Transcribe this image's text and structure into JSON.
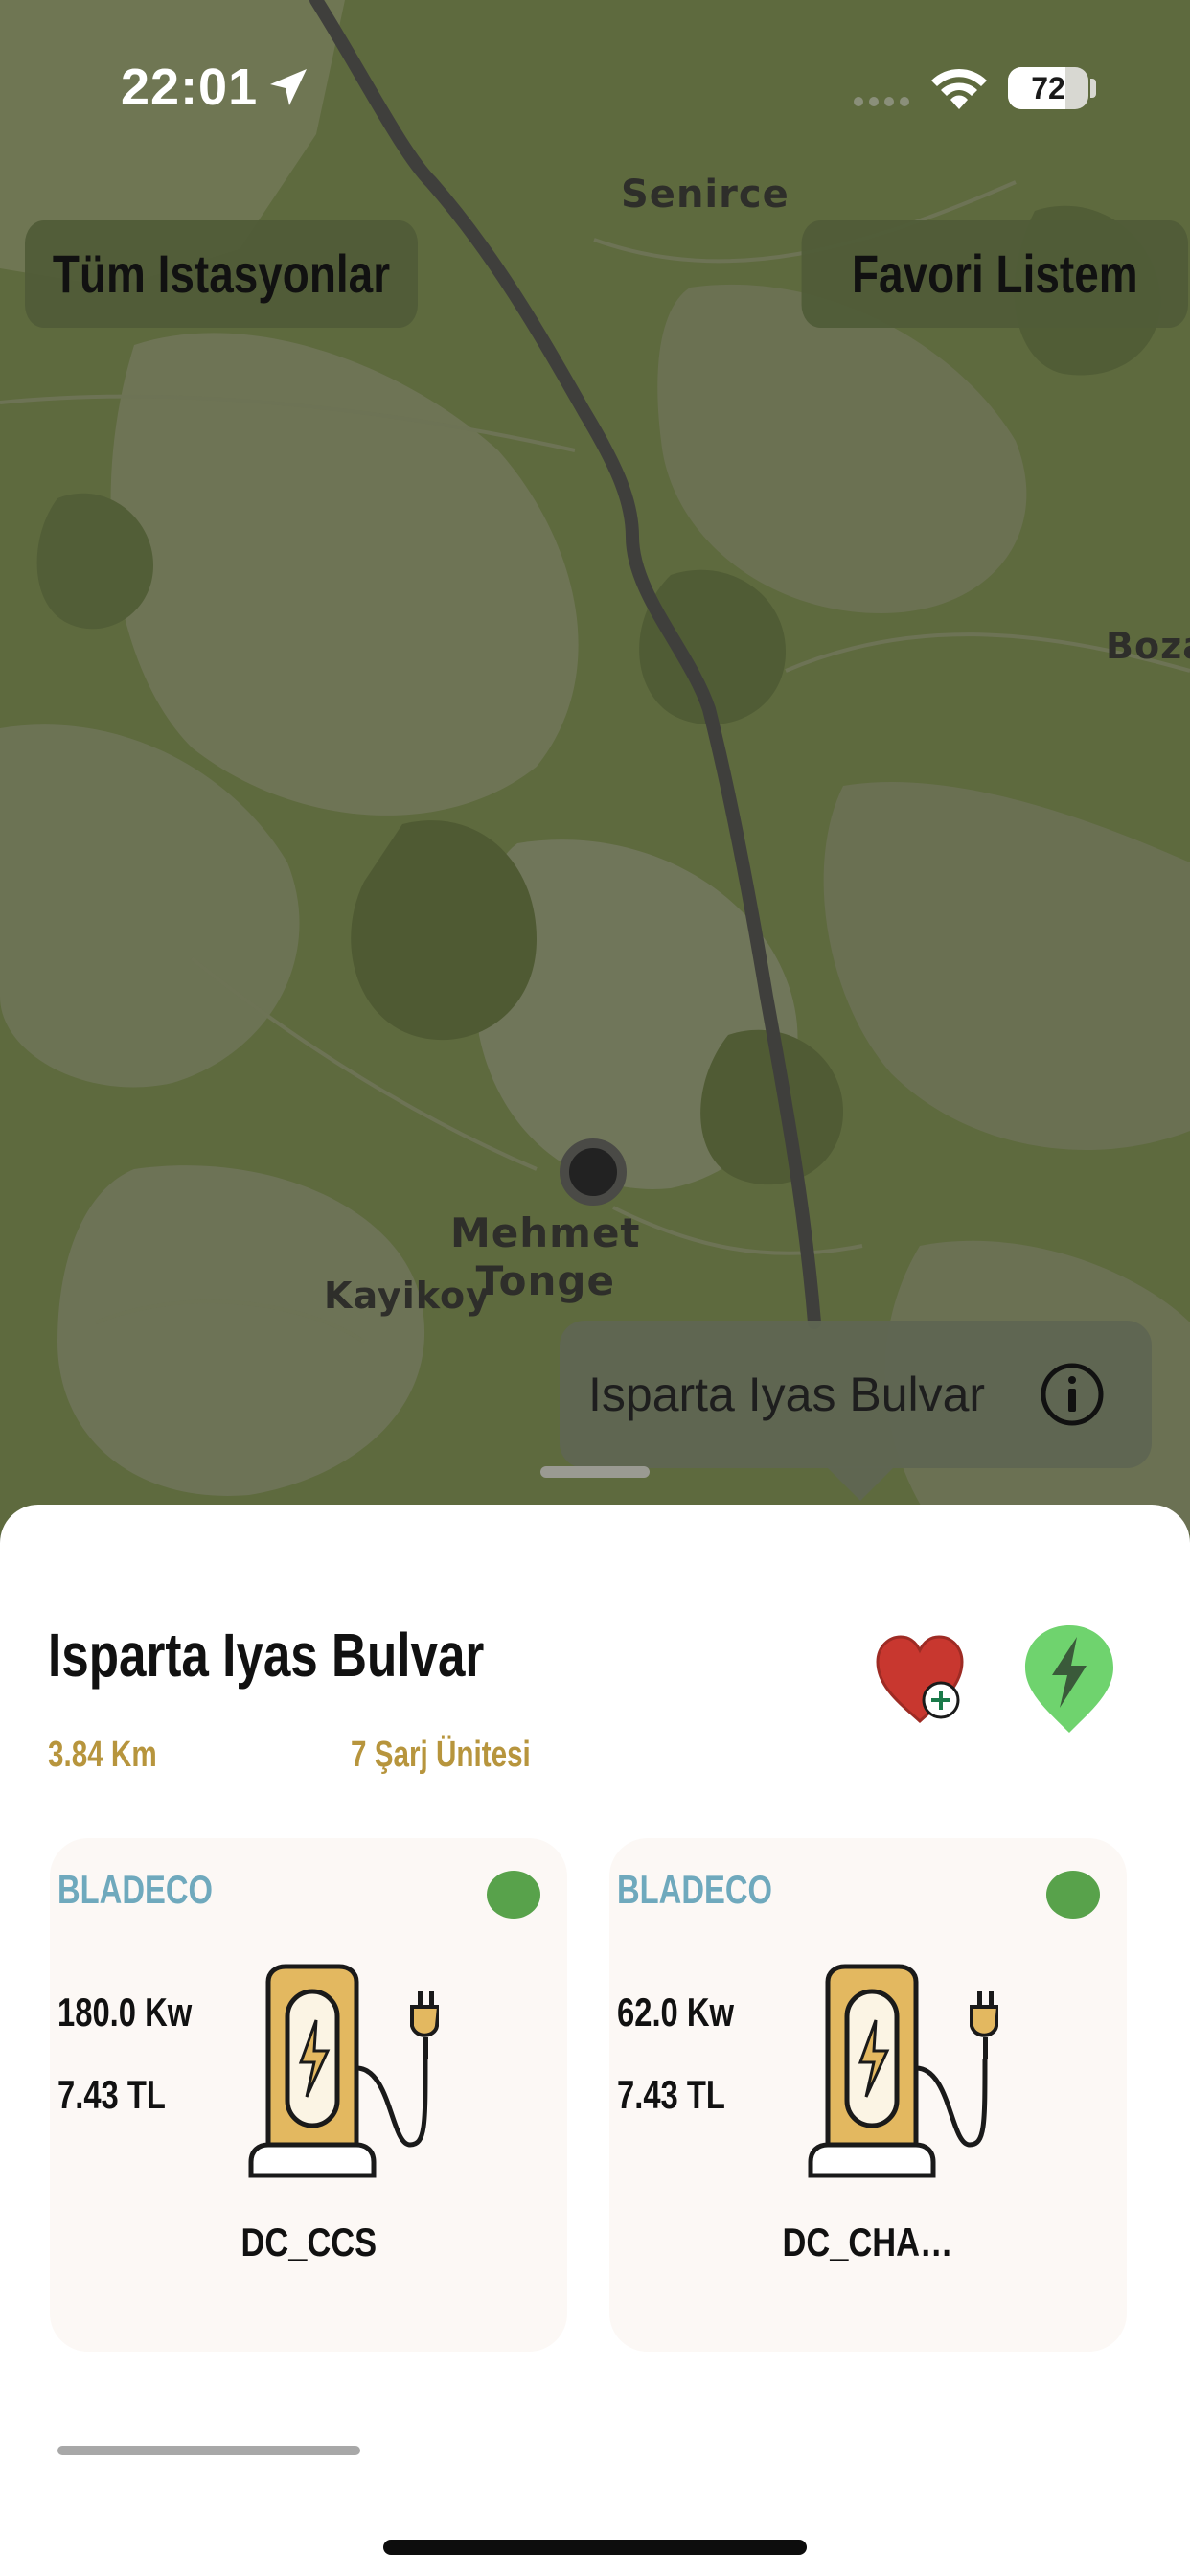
{
  "status_bar": {
    "time": "22:01",
    "battery": "72",
    "battery_level": 0.72,
    "location_icon": "location-arrow-icon",
    "wifi_icon": "wifi-icon"
  },
  "map": {
    "labels": {
      "senirce": "Senirce",
      "boza": "Boza",
      "mehmet": "Mehmet",
      "tonge": "Tonge",
      "kayikoy": "Kayikoy"
    },
    "buttons": {
      "all_stations": "Tüm Istasyonlar",
      "favorites": "Favori Listem"
    },
    "callout": {
      "title": "Isparta Iyas Bulvar",
      "icon": "info-icon"
    }
  },
  "station": {
    "name": "Isparta Iyas Bulvar",
    "distance": "3.84 Km",
    "units": "7 Şarj Ünitesi",
    "fav_icon": "heart-add-icon",
    "charge_icon": "charge-pin-icon"
  },
  "cards": [
    {
      "brand": "BLADECO",
      "power": "180.0 Kw",
      "price": "7.43 TL",
      "connector": "DC_CCS",
      "status_color": "#58a24b"
    },
    {
      "brand": "BLADECO",
      "power": "62.0 Kw",
      "price": "7.43 TL",
      "connector": "DC_CHA…",
      "status_color": "#58a24b"
    }
  ],
  "colors": {
    "accent_gold": "#b7953d",
    "brand_blue": "#6fa9bd",
    "status_green": "#58a24b",
    "heart_red": "#c8372f",
    "pin_green": "#6fd36e"
  }
}
